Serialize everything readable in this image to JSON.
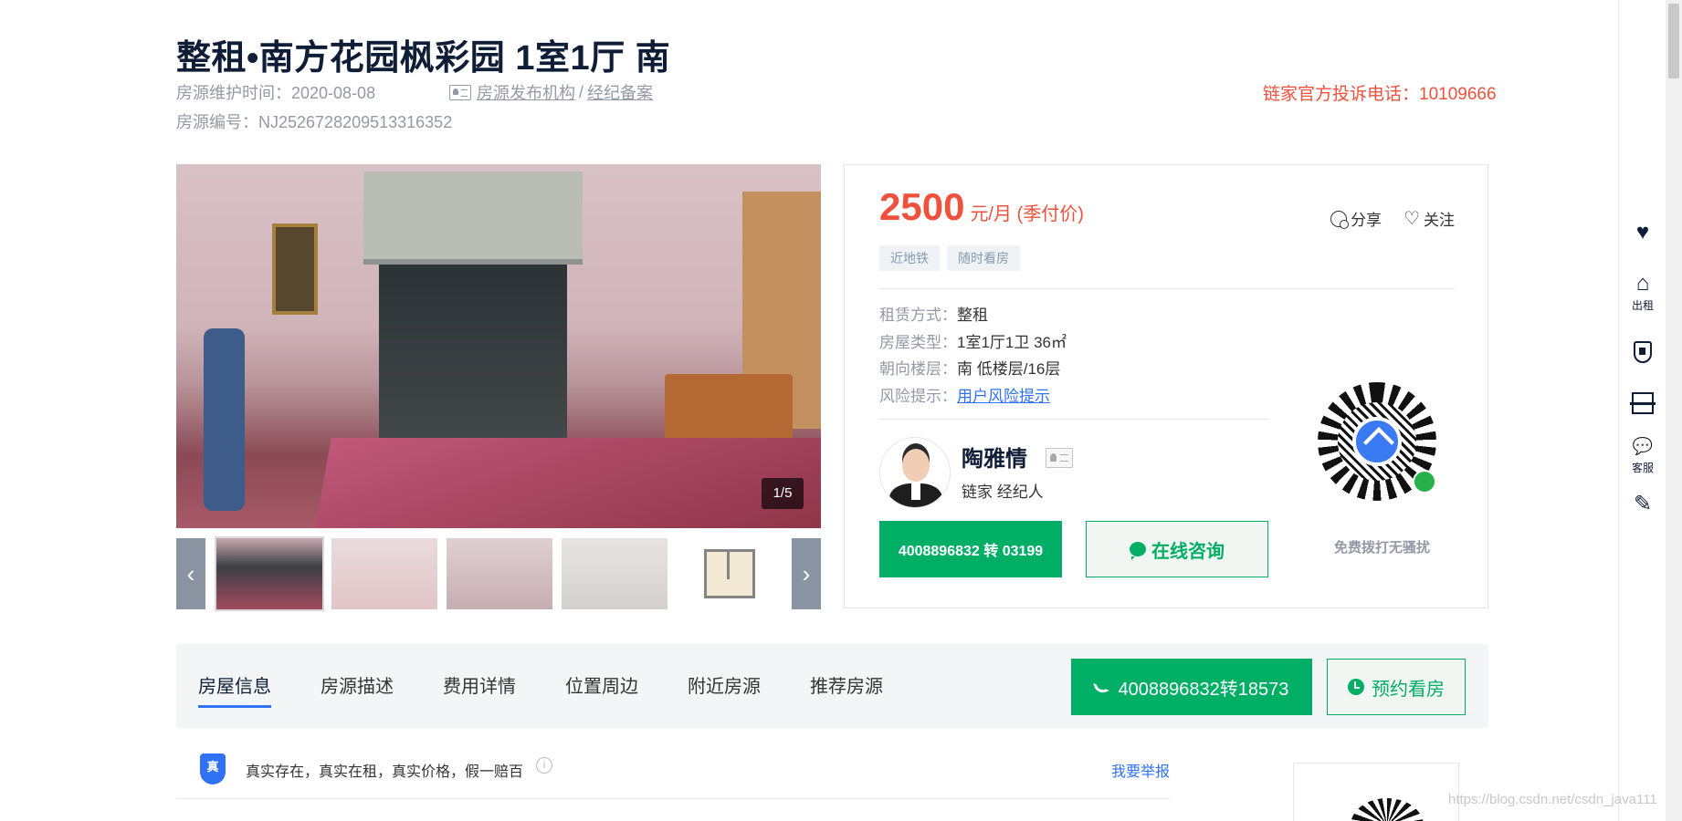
{
  "header": {
    "title": "整租•南方花园枫彩园 1室1厅 南",
    "maintain_label": "房源维护时间：",
    "maintain_date": "2020-08-08",
    "org_link": "房源发布机构",
    "org_sep": "/",
    "record_link": "经纪备案",
    "house_code_label": "房源编号：",
    "house_code": "NJ2526728209513316352",
    "complaint": "链家官方投诉电话：10109666"
  },
  "gallery": {
    "counter": "1/5",
    "prev_icon": "chevron-left-icon",
    "next_icon": "chevron-right-icon",
    "prev_glyph": "‹",
    "next_glyph": "›"
  },
  "info": {
    "price": "2500",
    "price_unit": "元/月 (季付价)",
    "share": "分享",
    "follow": "关注",
    "heart_glyph": "♡",
    "tags": [
      "近地铁",
      "随时看房"
    ],
    "props": [
      {
        "label": "租赁方式：",
        "value": "整租"
      },
      {
        "label": "房屋类型：",
        "value": "1室1厅1卫 36㎡"
      },
      {
        "label": "朝向楼层：",
        "value": "南 低楼层/16层"
      },
      {
        "label": "风险提示：",
        "value": "用户风险提示"
      }
    ],
    "agent_name": "陶雅情",
    "agent_role": "链家 经纪人",
    "phone_button": "4008896832 转 03199",
    "consult_button": "在线咨询",
    "qr_note": "免费拨打无骚扰"
  },
  "tabbar": {
    "tabs": [
      "房屋信息",
      "房源描述",
      "费用详情",
      "位置周边",
      "附近房源",
      "推荐房源"
    ],
    "call_button": "4008896832转18573",
    "appointment_button": "预约看房"
  },
  "guarantee": {
    "badge": "真",
    "text": "真实存在，真实在租，真实价格，假一赔百",
    "info_glyph": "i",
    "report": "我要举报"
  },
  "sidebar": {
    "items": [
      {
        "icon": "heart-icon",
        "glyph": "♥",
        "label": ""
      },
      {
        "icon": "house-icon",
        "glyph": "⌂",
        "label": "出租"
      },
      {
        "icon": "shield-icon",
        "label": ""
      },
      {
        "icon": "scan-icon",
        "label": ""
      },
      {
        "icon": "chat-icon",
        "glyph": "💬",
        "label": "客服"
      },
      {
        "icon": "edit-icon",
        "glyph": "✎",
        "label": ""
      }
    ]
  },
  "watermark": "https://blog.csdn.net/csdn_java111"
}
